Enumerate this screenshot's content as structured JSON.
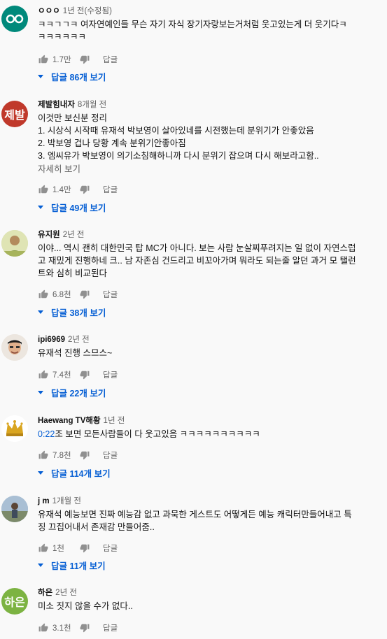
{
  "comments": [
    {
      "author": "ㅇㅇㅇ",
      "time": "1년 전(수정됨)",
      "lines": [
        "ㅋㅋㄱㄱㅋ 여자연예인들 무슨 자기 자식 장기자랑보는거처럼 웃고있는게 더 웃기다ㅋ",
        "ㅋㅋㅋㅋㅋㅋ"
      ],
      "likes": "1.7만",
      "reply_label": "답글",
      "replies_label": "답글 86개 보기"
    },
    {
      "author": "제발힘내자",
      "time": "8개월 전",
      "avatar_text": "제발",
      "lines": [
        "이것만 보신분 정리",
        "1. 시상식 시작때 유재석 박보영이 살아있네를 시전했는데 분위기가 안좋았음",
        "2. 박보영 겁나 당황 계속 분위기안좋아짐",
        "3. 엠씨유가 박보영이 의기소침해하니까 다시 분위기 잡으며 다시 해보라고함.."
      ],
      "more_label": "자세히 보기",
      "likes": "1.4만",
      "reply_label": "답글",
      "replies_label": "답글 49개 보기"
    },
    {
      "author": "유지원",
      "time": "2년 전",
      "lines": [
        "이야... 역시 괜히 대한민국 탑 MC가 아니다. 보는 사람 눈살찌푸려지는 일 없이 자연스럽",
        "고 재밌게 진행하네 크.. 남 자존심 건드리고 비꼬아가며 뭐라도 되는줄 알던 과거 모 탤런",
        "트와 심히 비교된다"
      ],
      "likes": "6.8천",
      "reply_label": "답글",
      "replies_label": "답글 38개 보기"
    },
    {
      "author": "ipi6969",
      "time": "2년 전",
      "lines": [
        "유재석 진행 스므스~"
      ],
      "likes": "7.4천",
      "reply_label": "답글",
      "replies_label": "답글 22개 보기"
    },
    {
      "author": "Haewang TV해황",
      "time": "1년 전",
      "timestamp_link": "0:22",
      "lines": [
        "조 보면 모든사람들이 다 웃고있음 ㅋㅋㅋㅋㅋㅋㅋㅋㅋㅋ"
      ],
      "likes": "7.8천",
      "reply_label": "답글",
      "replies_label": "답글 114개 보기"
    },
    {
      "author": "j m",
      "time": "1개월 전",
      "lines": [
        "유재석 예능보면 진짜 예능감 없고 과묵한 게스트도 어떻게든 예능 캐릭터만들어내고 특",
        "징 끄집어내서 존재감 만들어줌.."
      ],
      "likes": "1천",
      "reply_label": "답글",
      "replies_label": "답글 11개 보기"
    },
    {
      "author": "하은",
      "time": "2년 전",
      "avatar_text": "하은",
      "lines": [
        "미소 짓지 않을 수가 없다.."
      ],
      "likes": "3.1천",
      "reply_label": "답글"
    }
  ],
  "colors": {
    "link_blue": "#065fd4",
    "secondary_text": "#606060",
    "background": "#f9f9f9",
    "avatar_red": "#c0392b",
    "avatar_green": "#7cb342",
    "avatar_teal": "#00897b"
  }
}
